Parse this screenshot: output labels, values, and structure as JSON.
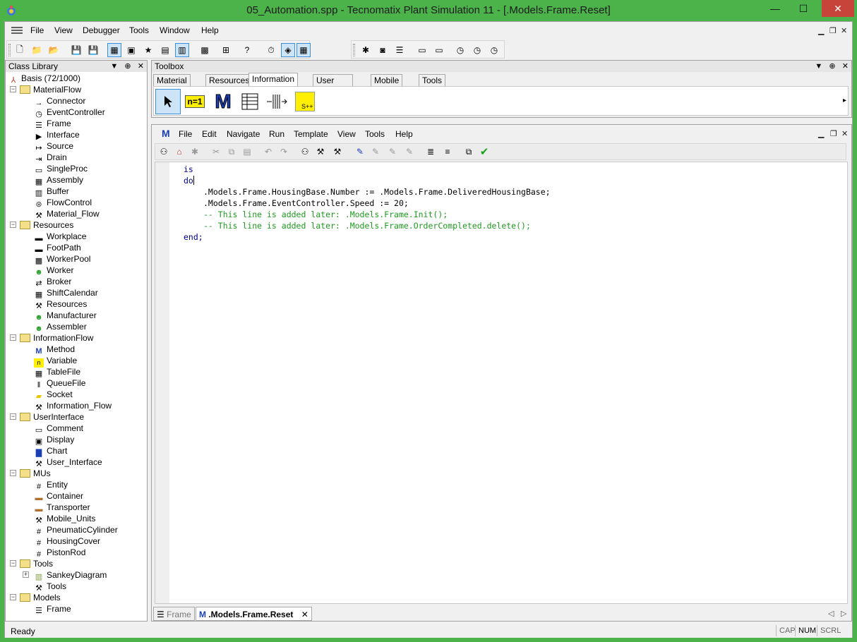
{
  "window": {
    "title": "05_Automation.spp - Tecnomatix Plant Simulation 11 - [.Models.Frame.Reset]",
    "minimize": "—",
    "maximize": "☐",
    "close": "✕"
  },
  "menubar": {
    "items": [
      "File",
      "View",
      "Debugger",
      "Tools",
      "Window",
      "Help"
    ]
  },
  "class_library": {
    "title": "Class Library",
    "root": "Basis (72/1000)",
    "tree": [
      {
        "label": "MaterialFlow",
        "type": "folder",
        "depth": 1
      },
      {
        "label": "Connector",
        "type": "item",
        "icon": "connector-icon",
        "depth": 2
      },
      {
        "label": "EventController",
        "type": "item",
        "icon": "clock-icon",
        "depth": 2
      },
      {
        "label": "Frame",
        "type": "item",
        "icon": "frame-icon",
        "depth": 2
      },
      {
        "label": "Interface",
        "type": "item",
        "icon": "interface-icon",
        "depth": 2
      },
      {
        "label": "Source",
        "type": "item",
        "icon": "source-icon",
        "depth": 2
      },
      {
        "label": "Drain",
        "type": "item",
        "icon": "drain-icon",
        "depth": 2
      },
      {
        "label": "SingleProc",
        "type": "item",
        "icon": "singleproc-icon",
        "depth": 2
      },
      {
        "label": "Assembly",
        "type": "item",
        "icon": "assembly-icon",
        "depth": 2
      },
      {
        "label": "Buffer",
        "type": "item",
        "icon": "buffer-icon",
        "depth": 2
      },
      {
        "label": "FlowControl",
        "type": "item",
        "icon": "flowcontrol-icon",
        "depth": 2
      },
      {
        "label": "Material_Flow",
        "type": "item",
        "icon": "toolbox-icon",
        "depth": 2
      },
      {
        "label": "Resources",
        "type": "folder",
        "depth": 1
      },
      {
        "label": "Workplace",
        "type": "item",
        "icon": "workplace-icon",
        "depth": 2
      },
      {
        "label": "FootPath",
        "type": "item",
        "icon": "footpath-icon",
        "depth": 2
      },
      {
        "label": "WorkerPool",
        "type": "item",
        "icon": "workerpool-icon",
        "depth": 2
      },
      {
        "label": "Worker",
        "type": "item",
        "icon": "worker-icon",
        "depth": 2
      },
      {
        "label": "Broker",
        "type": "item",
        "icon": "broker-icon",
        "depth": 2
      },
      {
        "label": "ShiftCalendar",
        "type": "item",
        "icon": "calendar-icon",
        "depth": 2
      },
      {
        "label": "Resources",
        "type": "item",
        "icon": "toolbox-icon",
        "depth": 2
      },
      {
        "label": "Manufacturer",
        "type": "item",
        "icon": "worker-icon",
        "depth": 2
      },
      {
        "label": "Assembler",
        "type": "item",
        "icon": "worker-icon",
        "depth": 2
      },
      {
        "label": "InformationFlow",
        "type": "folder",
        "depth": 1
      },
      {
        "label": "Method",
        "type": "item",
        "icon": "method-icon",
        "depth": 2
      },
      {
        "label": "Variable",
        "type": "item",
        "icon": "variable-icon",
        "depth": 2
      },
      {
        "label": "TableFile",
        "type": "item",
        "icon": "table-icon",
        "depth": 2
      },
      {
        "label": "QueueFile",
        "type": "item",
        "icon": "queue-icon",
        "depth": 2
      },
      {
        "label": "Socket",
        "type": "item",
        "icon": "socket-icon",
        "depth": 2
      },
      {
        "label": "Information_Flow",
        "type": "item",
        "icon": "toolbox-icon",
        "depth": 2
      },
      {
        "label": "UserInterface",
        "type": "folder",
        "depth": 1
      },
      {
        "label": "Comment",
        "type": "item",
        "icon": "comment-icon",
        "depth": 2
      },
      {
        "label": "Display",
        "type": "item",
        "icon": "display-icon",
        "depth": 2
      },
      {
        "label": "Chart",
        "type": "item",
        "icon": "chart-icon",
        "depth": 2
      },
      {
        "label": "User_Interface",
        "type": "item",
        "icon": "toolbox-icon",
        "depth": 2
      },
      {
        "label": "MUs",
        "type": "folder",
        "depth": 1
      },
      {
        "label": "Entity",
        "type": "item",
        "icon": "entity-icon",
        "depth": 2
      },
      {
        "label": "Container",
        "type": "item",
        "icon": "container-icon",
        "depth": 2
      },
      {
        "label": "Transporter",
        "type": "item",
        "icon": "transporter-icon",
        "depth": 2
      },
      {
        "label": "Mobile_Units",
        "type": "item",
        "icon": "toolbox-icon",
        "depth": 2
      },
      {
        "label": "PneumaticCylinder",
        "type": "item",
        "icon": "entity-icon",
        "depth": 2
      },
      {
        "label": "HousingCover",
        "type": "item",
        "icon": "entity-icon",
        "depth": 2
      },
      {
        "label": "PistonRod",
        "type": "item",
        "icon": "entity-icon",
        "depth": 2
      },
      {
        "label": "Tools",
        "type": "folder",
        "depth": 1
      },
      {
        "label": "SankeyDiagram",
        "type": "item",
        "icon": "sankey-icon",
        "depth": 2,
        "expander": "+"
      },
      {
        "label": "Tools",
        "type": "item",
        "icon": "toolbox-icon",
        "depth": 2
      },
      {
        "label": "Models",
        "type": "folder",
        "depth": 1
      },
      {
        "label": "Frame",
        "type": "item",
        "icon": "frame-icon",
        "depth": 2
      }
    ]
  },
  "toolbox": {
    "title": "Toolbox",
    "tabs": [
      "Material Flow",
      "Resources",
      "Information Flow",
      "User Interface",
      "Mobile Units",
      "Tools"
    ],
    "active_tab": "Information Flow",
    "variable_label": "n=1",
    "method_label": "M",
    "socket_label": "S++",
    "scroll_arrow": "▸"
  },
  "editor": {
    "menu": [
      "File",
      "Edit",
      "Navigate",
      "Run",
      "Template",
      "View",
      "Tools",
      "Help"
    ],
    "method_logo": "M",
    "code": [
      {
        "text": "is",
        "cls": "kw",
        "indent": 0
      },
      {
        "text": "do",
        "cls": "kw",
        "indent": 0,
        "caret": true
      },
      {
        "text": ".Models.Frame.HousingBase.Number := .Models.Frame.DeliveredHousingBase;",
        "cls": "",
        "indent": 1
      },
      {
        "text": ".Models.Frame.EventController.Speed := 20;",
        "cls": "",
        "indent": 1
      },
      {
        "text": "-- This line is added later: .Models.Frame.Init();",
        "cls": "cm",
        "indent": 1
      },
      {
        "text": "-- This line is added later: .Models.Frame.OrderCompleted.delete();",
        "cls": "cm",
        "indent": 1
      },
      {
        "text": "end;",
        "cls": "kw",
        "indent": 0
      }
    ],
    "doc_tabs": [
      {
        "label": "Frame",
        "active": false
      },
      {
        "label": ".Models.Frame.Reset",
        "active": true
      }
    ],
    "tab_close": "✕",
    "nav_prev": "◁",
    "nav_next": "▷"
  },
  "panel_buttons": {
    "dropdown": "▼",
    "pin": "⊕",
    "close": "✕"
  },
  "status": {
    "text": "Ready",
    "indicators": [
      {
        "label": "CAP",
        "on": false
      },
      {
        "label": "NUM",
        "on": true
      },
      {
        "label": "SCRL",
        "on": false
      }
    ]
  },
  "colors": {
    "frame": "#4cb34a",
    "keyword": "#00008b",
    "comment": "#1f9a1f",
    "close_button": "#c7443b"
  }
}
